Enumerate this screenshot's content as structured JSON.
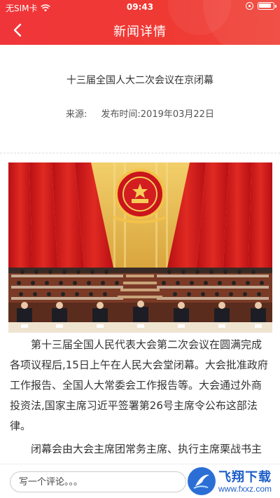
{
  "status_bar": {
    "carrier": "无SIM卡",
    "time": "09:43"
  },
  "nav": {
    "title": "新闻详情",
    "back_icon": "chevron-left-icon"
  },
  "article": {
    "title": "十三届全国人大二次会议在京闭幕",
    "source_label": "来源:",
    "publish_label": "发布时间:2019年03月22日",
    "paragraphs": [
      "第十三届全国人民代表大会第二次会议在圆满完成各项议程后,15日上午在人民大会堂闭幕。大会批准政府工作报告、全国人大常委会工作报告等。大会通过外商投资法,国家主席习近平签署第26号主席令公布这部法律。",
      "闭幕会由大会主席团常务主席、执行主席栗战书主"
    ]
  },
  "footer": {
    "comment_placeholder": "写一个评论。。。",
    "watermark_text": "飞翔下载",
    "watermark_url": "www.fxxz.com"
  },
  "colors": {
    "header_red": "#f0353a",
    "watermark_blue": "#1e5fc8"
  }
}
